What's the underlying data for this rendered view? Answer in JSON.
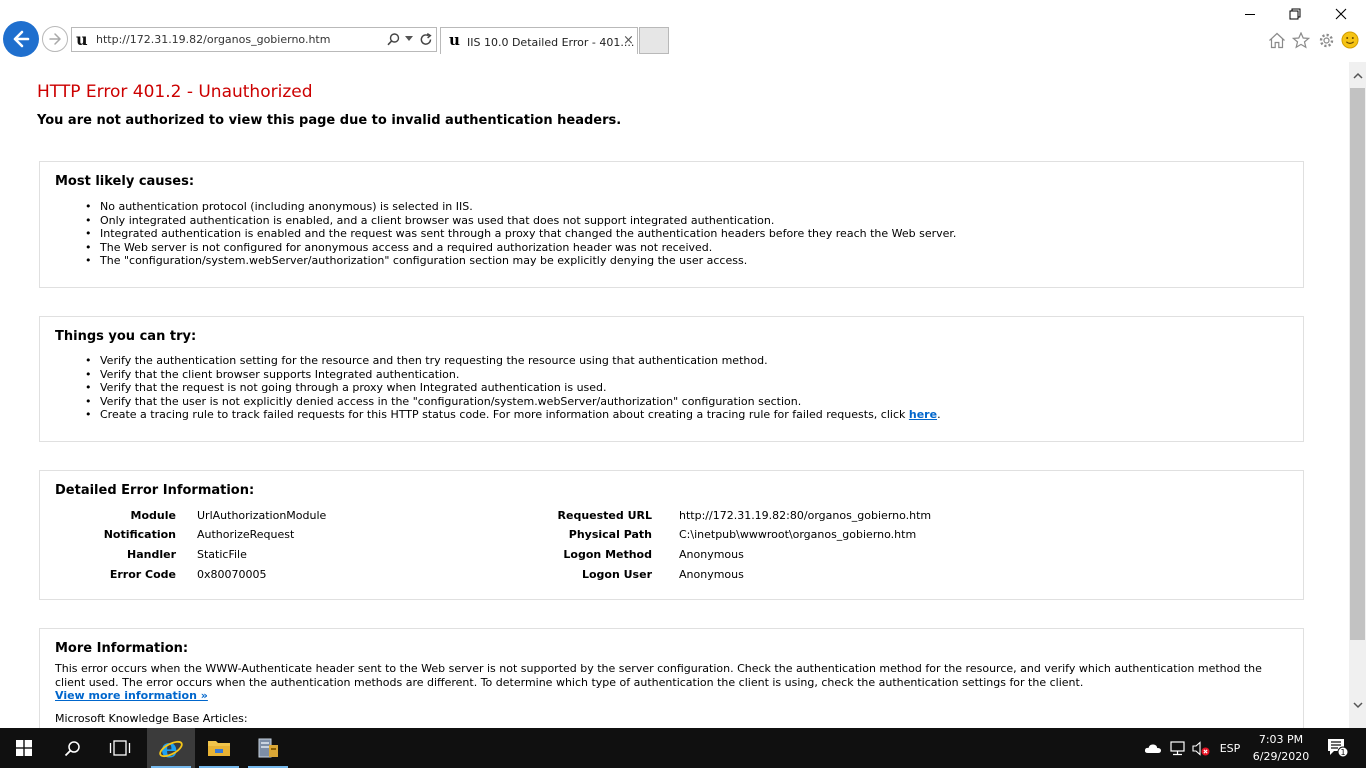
{
  "browser": {
    "url": "http://172.31.19.82/organos_gobierno.htm",
    "tab_title": "IIS 10.0 Detailed Error - 401....",
    "favicon_letter": "u",
    "tab_close": "×"
  },
  "page": {
    "title": "HTTP Error 401.2 - Unauthorized",
    "subtitle": "You are not authorized to view this page due to invalid authentication headers.",
    "causes": {
      "heading": "Most likely causes:",
      "items": [
        "No authentication protocol (including anonymous) is selected in IIS.",
        "Only integrated authentication is enabled, and a client browser was used that does not support integrated authentication.",
        "Integrated authentication is enabled and the request was sent through a proxy that changed the authentication headers before they reach the Web server.",
        "The Web server is not configured for anonymous access and a required authorization header was not received.",
        "The \"configuration/system.webServer/authorization\" configuration section may be explicitly denying the user access."
      ]
    },
    "try": {
      "heading": "Things you can try:",
      "items": [
        "Verify the authentication setting for the resource and then try requesting the resource using that authentication method.",
        "Verify that the client browser supports Integrated authentication.",
        "Verify that the request is not going through a proxy when Integrated authentication is used.",
        "Verify that the user is not explicitly denied access in the \"configuration/system.webServer/authorization\" configuration section."
      ],
      "last_item_text": "Create a tracing rule to track failed requests for this HTTP status code. For more information about creating a tracing rule for failed requests, click ",
      "last_item_link": "here",
      "last_item_end": "."
    },
    "details": {
      "heading": "Detailed Error Information:",
      "left": [
        {
          "label": "Module",
          "value": "UrlAuthorizationModule"
        },
        {
          "label": "Notification",
          "value": "AuthorizeRequest"
        },
        {
          "label": "Handler",
          "value": "StaticFile"
        },
        {
          "label": "Error Code",
          "value": "0x80070005"
        }
      ],
      "right": [
        {
          "label": "Requested URL",
          "value": "http://172.31.19.82:80/organos_gobierno.htm"
        },
        {
          "label": "Physical Path",
          "value": "C:\\inetpub\\wwwroot\\organos_gobierno.htm"
        },
        {
          "label": "Logon Method",
          "value": "Anonymous"
        },
        {
          "label": "Logon User",
          "value": "Anonymous"
        }
      ]
    },
    "more": {
      "heading": "More Information:",
      "text": "This error occurs when the WWW-Authenticate header sent to the Web server is not supported by the server configuration. Check the authentication method for the resource, and verify which authentication method the client used. The error occurs when the authentication methods are different. To determine which type of authentication the client is using, check the authentication settings for the client.",
      "link": "View more information »",
      "kb": "Microsoft Knowledge Base Articles:"
    }
  },
  "taskbar": {
    "language": "ESP",
    "time": "7:03 PM",
    "date": "6/29/2020",
    "notification_count": "1"
  },
  "colors": {
    "title_red": "#cc0000",
    "link_blue": "#0066cc",
    "ie_blue": "#1f6fce",
    "taskbar": "#101010"
  }
}
